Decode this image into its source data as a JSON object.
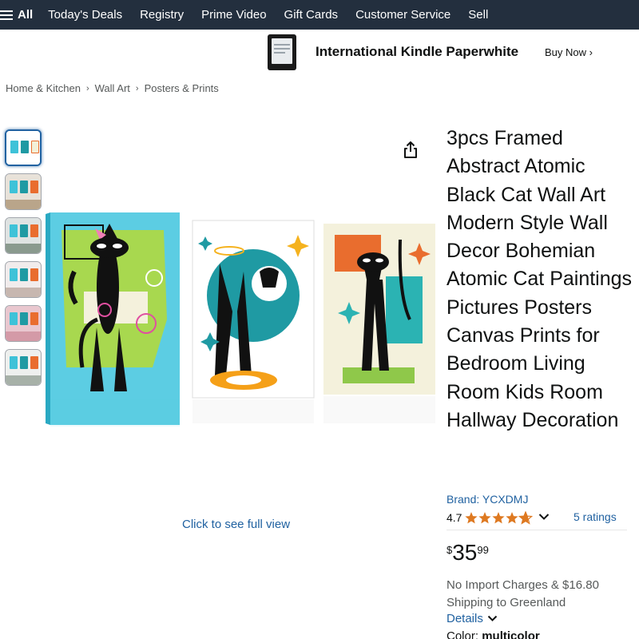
{
  "nav": {
    "all_label": "All",
    "links": [
      "Today's Deals",
      "Registry",
      "Prime Video",
      "Gift Cards",
      "Customer Service",
      "Sell"
    ]
  },
  "promo": {
    "title": "International Kindle Paperwhite",
    "cta": "Buy Now ›"
  },
  "breadcrumb": [
    "Home & Kitchen",
    "Wall Art",
    "Posters & Prints"
  ],
  "thumbnails": {
    "count": 6,
    "active_index": 0
  },
  "gallery": {
    "full_view_label": "Click to see full view"
  },
  "product": {
    "title": "3pcs Framed Abstract Atomic Black Cat Wall Art Modern Style Wall Decor Bohemian Atomic Cat Paintings Pictures Posters Canvas Prints for Bedroom Living Room Kids Room Hallway Decoration",
    "brand": "Brand: YCXDMJ",
    "rating": "4.7",
    "rating_value": 4.7,
    "ratings_count": "5 ratings",
    "price": {
      "symbol": "$",
      "whole": "35",
      "fraction": "99"
    },
    "shipping_line1": "No Import Charges & $16.80",
    "shipping_line2": "Shipping to Greenland",
    "details_label": "Details",
    "color_label": "Color:",
    "color_value": "multicolor"
  },
  "colors": {
    "nav_bg": "#232f3e",
    "link": "#2162a1",
    "star": "#de7921",
    "text": "#0f1111",
    "muted": "#565959"
  },
  "icons": [
    "hamburger-icon",
    "share-icon",
    "star-icon",
    "chevron-down-icon",
    "kindle-device-icon"
  ]
}
